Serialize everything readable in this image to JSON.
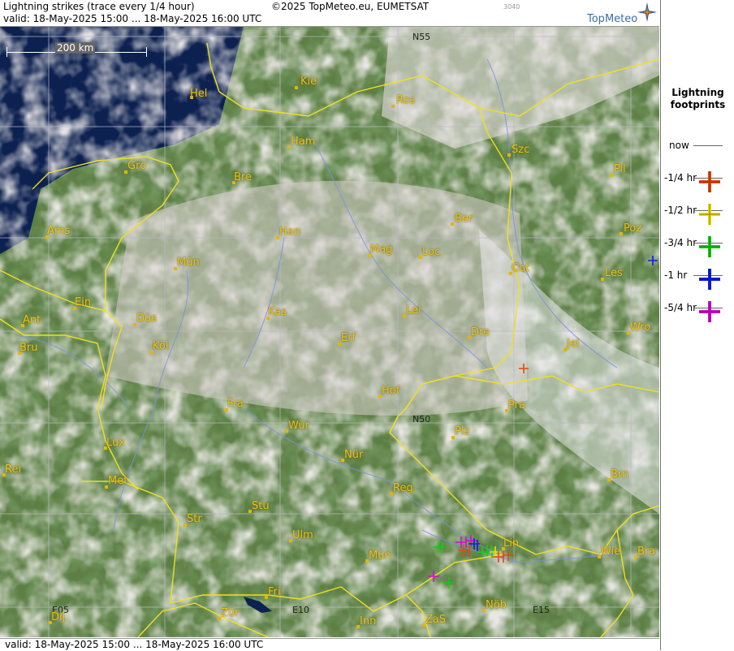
{
  "header": {
    "title": "Lightning strikes (trace every 1/4 hour)",
    "valid": "valid:  18-May-2025 15:00 ... 18-May-2025 16:00 UTC",
    "copyright": "©2025 TopMeteo.eu, EUMETSAT",
    "code": "3040",
    "logo": "TopMeteo"
  },
  "footer": {
    "valid": "valid:  18-May-2025 15:00 ... 18-May-2025 16:00 UTC"
  },
  "scale_bar": "200 km",
  "legend": {
    "title": "Lightning footprints",
    "items": [
      {
        "label": "now",
        "color": null
      },
      {
        "label": "-1/4 hr",
        "color": "#e04a10"
      },
      {
        "label": "-1/2 hr",
        "color": "#e8e000"
      },
      {
        "label": "-3/4 hr",
        "color": "#10d010"
      },
      {
        "label": "-1 hr",
        "color": "#1020e0"
      },
      {
        "label": "-5/4 hr",
        "color": "#d010d0"
      }
    ]
  },
  "grid_labels": [
    "N55",
    "N50",
    "E05",
    "E10",
    "E15"
  ],
  "cities": [
    "Hel",
    "Kie",
    "Ros",
    "Ham",
    "Szc",
    "Gro",
    "Bre",
    "Pil",
    "Ber",
    "Ams",
    "Han",
    "Poz",
    "Mag",
    "Loc",
    "Mün",
    "Cot",
    "Les",
    "Ein",
    "Kas",
    "Lei",
    "Ant",
    "Düs",
    "Wro",
    "Erf",
    "Dre",
    "Bru",
    "Köl",
    "Jel",
    "Hof",
    "Fra",
    "Pra",
    "Wür",
    "Plz",
    "Lux",
    "Nür",
    "Rei",
    "Met",
    "Brn",
    "Reg",
    "Stu",
    "Str",
    "Ulm",
    "Lin",
    "Mün",
    "Wie",
    "Bra",
    "Fri",
    "Dij",
    "Zür",
    "Inn",
    "ZaS",
    "Nöb"
  ],
  "colors": {
    "sea": "#0d2150",
    "land": "#4f7a3c",
    "cloud": "#ded6d4",
    "border": "#f0e020",
    "river": "#7e8ee8",
    "city_label": "#e8c318"
  }
}
